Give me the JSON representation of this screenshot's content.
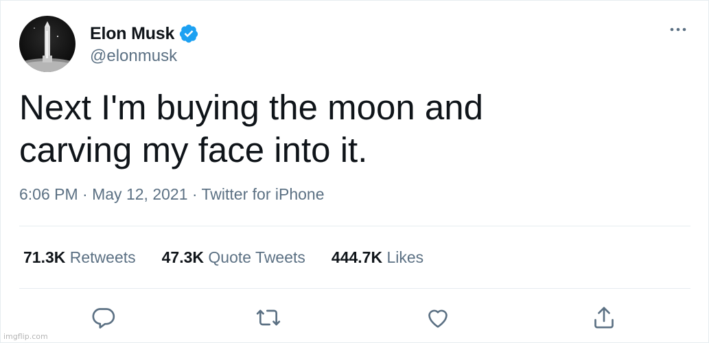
{
  "author": {
    "display_name": "Elon Musk",
    "handle": "@elonmusk",
    "verified": true
  },
  "tweet": {
    "text": "Next I'm buying the moon and\ncarving my face into it.",
    "time": "6:06 PM",
    "separator": " · ",
    "date": "May 12, 2021",
    "source": "Twitter for iPhone"
  },
  "stats": {
    "retweets_count": "71.3K",
    "retweets_label": "Retweets",
    "quotes_count": "47.3K",
    "quotes_label": "Quote Tweets",
    "likes_count": "444.7K",
    "likes_label": "Likes"
  },
  "icons": {
    "more": "more-dots-icon",
    "reply": "reply-icon",
    "retweet": "retweet-icon",
    "like": "heart-icon",
    "share": "share-icon"
  },
  "colors": {
    "text": "#0f1419",
    "secondary": "#5b7083",
    "verified": "#1da1f2",
    "divider": "#e6ecf0"
  },
  "watermark": "imgflip.com"
}
